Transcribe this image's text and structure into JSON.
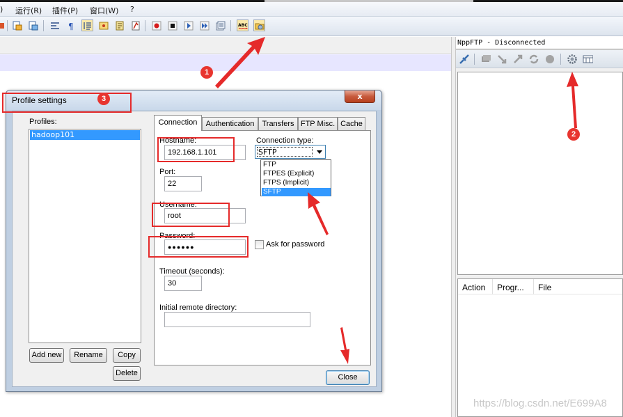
{
  "menubar": {
    "items": [
      {
        "label": ")"
      },
      {
        "label": "运行(R)"
      },
      {
        "label": "插件(P)"
      },
      {
        "label": "窗口(W)"
      },
      {
        "label": "?"
      }
    ]
  },
  "nppftp": {
    "title": "NppFTP - Disconnected",
    "queue_columns": [
      "Action",
      "Progr...",
      "File"
    ]
  },
  "dialog": {
    "title": "Profile settings",
    "close_glyph": "x",
    "profiles_label": "Profiles:",
    "profiles": [
      "hadoop101"
    ],
    "buttons": {
      "add_new": "Add new",
      "rename": "Rename",
      "copy": "Copy",
      "delete": "Delete",
      "close": "Close"
    },
    "tabs": [
      "Connection",
      "Authentication",
      "Transfers",
      "FTP Misc.",
      "Cache"
    ],
    "active_tab": "Connection",
    "connection": {
      "hostname_label": "Hostname:",
      "hostname": "192.168.1.101",
      "port_label": "Port:",
      "port": "22",
      "username_label": "Username:",
      "username": "root",
      "password_label": "Password:",
      "password_mask": "●●●●●●",
      "ask_for_password": "Ask for password",
      "ask_for_password_checked": false,
      "timeout_label": "Timeout (seconds):",
      "timeout": "30",
      "initial_dir_label": "Initial remote directory:",
      "initial_dir": "",
      "connection_type_label": "Connection type:",
      "connection_type": "SFTP",
      "connection_type_options": [
        "FTP",
        "FTPES (Explicit)",
        "FTPS (Implicit)",
        "SFTP"
      ]
    }
  },
  "annotations": {
    "badges": [
      "1",
      "2",
      "3"
    ],
    "color": "#e52a2a"
  },
  "watermark": "https://blog.csdn.net/E699A8"
}
